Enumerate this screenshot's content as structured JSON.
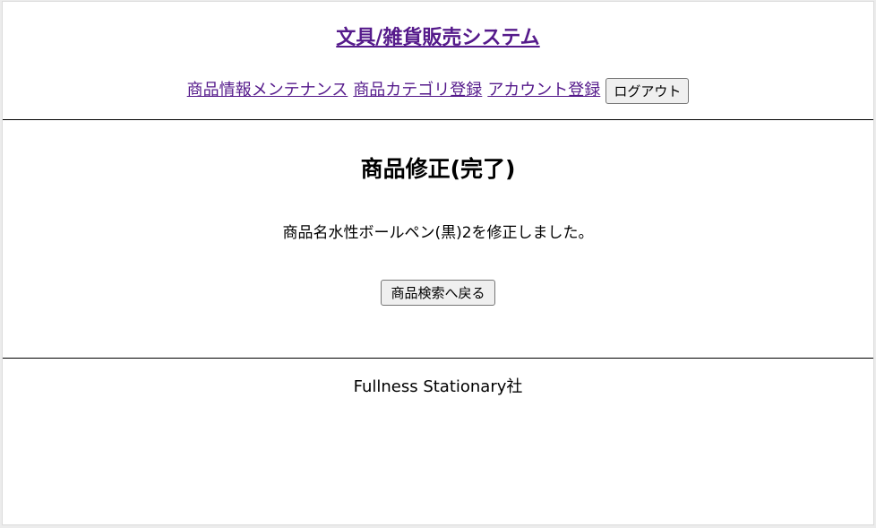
{
  "header": {
    "site_title": "文具/雑貨販売システム",
    "nav": {
      "product_maintenance": "商品情報メンテナンス",
      "category_registration": "商品カテゴリ登録",
      "account_registration": "アカウント登録",
      "logout_label": "ログアウト"
    }
  },
  "main": {
    "title": "商品修正(完了)",
    "message": "商品名水性ボールペン(黒)2を修正しました。",
    "back_button_label": "商品検索へ戻る"
  },
  "footer": {
    "company": "Fullness Stationary社"
  },
  "colors": {
    "link_visited": "#551a8b",
    "rule": "#000000",
    "background": "#ffffff"
  }
}
